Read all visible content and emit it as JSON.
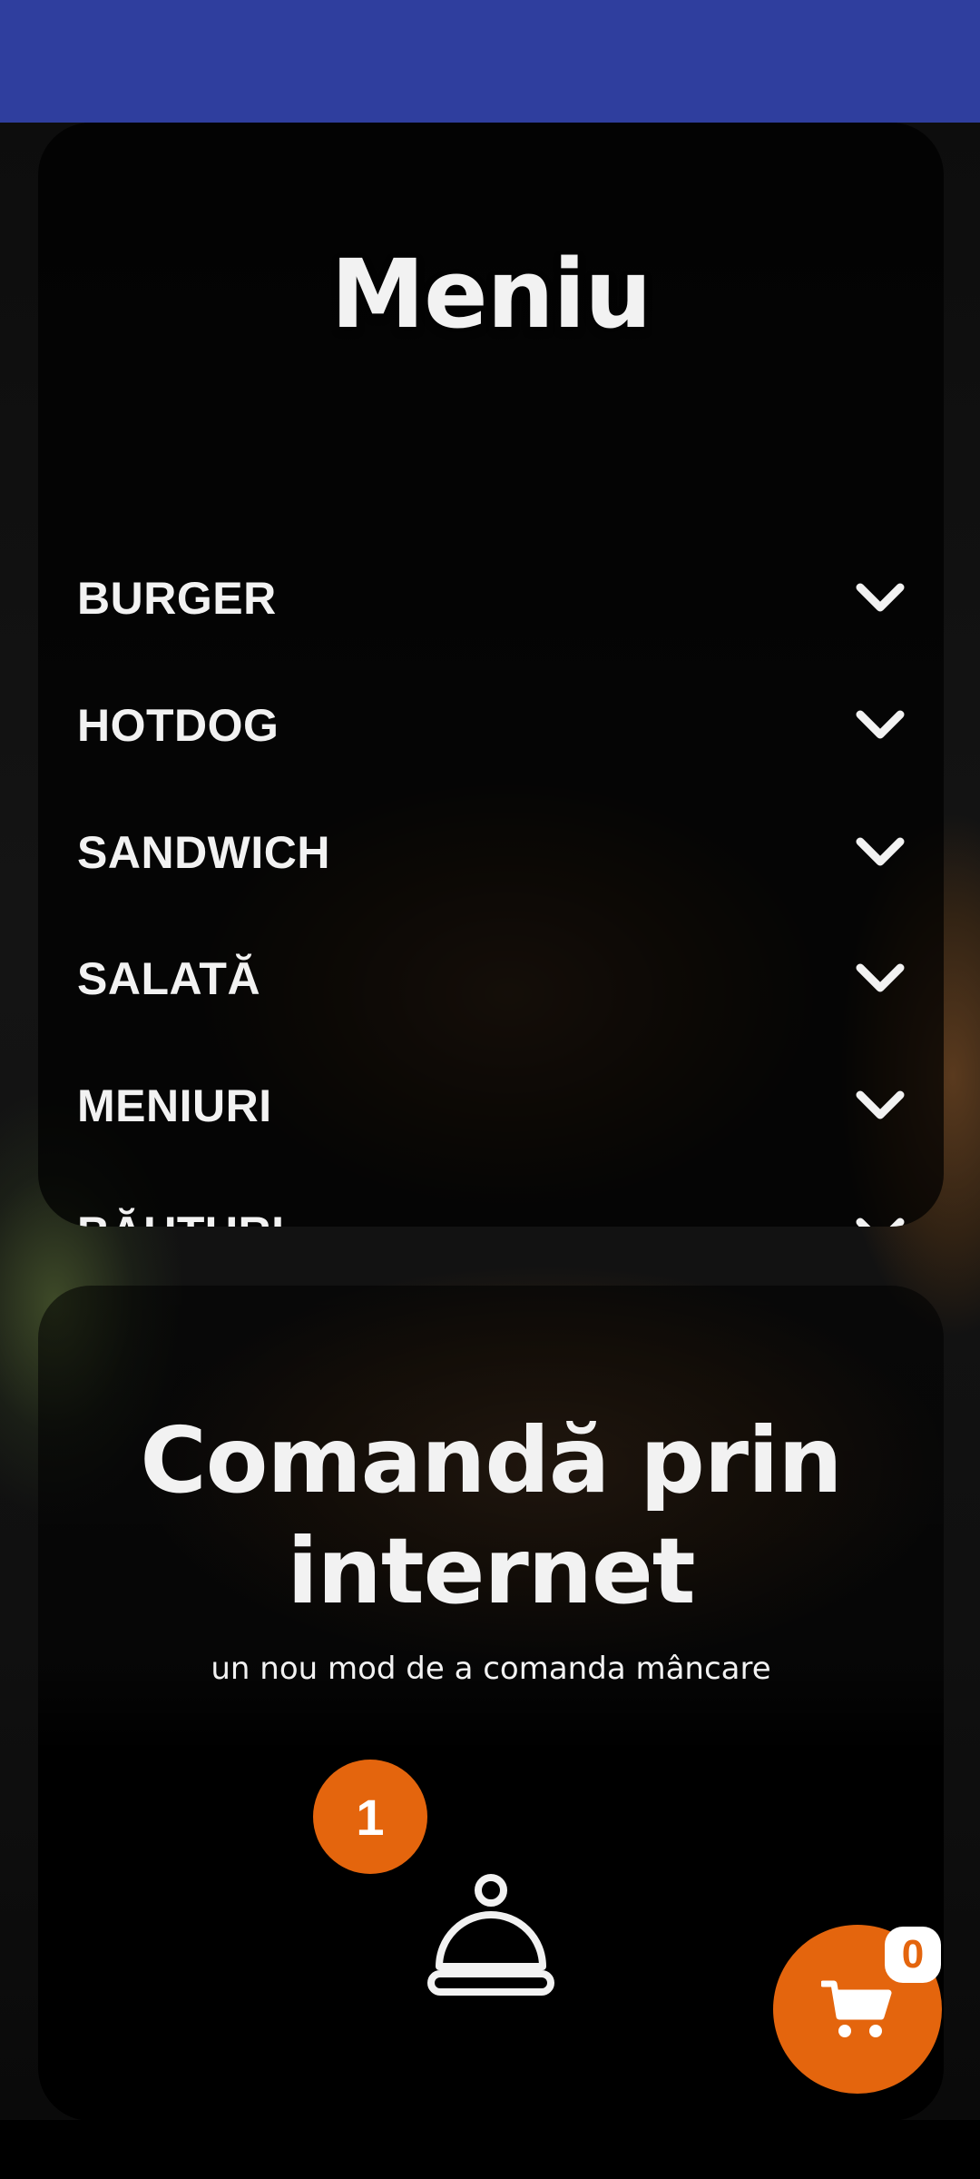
{
  "menu": {
    "title": "Meniu",
    "categories": [
      {
        "label": "BURGER"
      },
      {
        "label": "HOTDOG"
      },
      {
        "label": "SANDWICH"
      },
      {
        "label": "SALATĂ"
      },
      {
        "label": "MENIURI"
      },
      {
        "label": "BĂUTURI"
      }
    ]
  },
  "order": {
    "title_line1": "Comandă prin",
    "title_line2": "internet",
    "subtitle": "un nou mod de a comanda mâncare",
    "step_number": "1"
  },
  "cart": {
    "count": "0"
  },
  "colors": {
    "status_bar": "#2f3e9e",
    "accent": "#e4650d",
    "text": "#f2f2f2"
  },
  "icons": [
    "chevron-down-icon",
    "cloche-icon",
    "shopping-cart-icon"
  ]
}
